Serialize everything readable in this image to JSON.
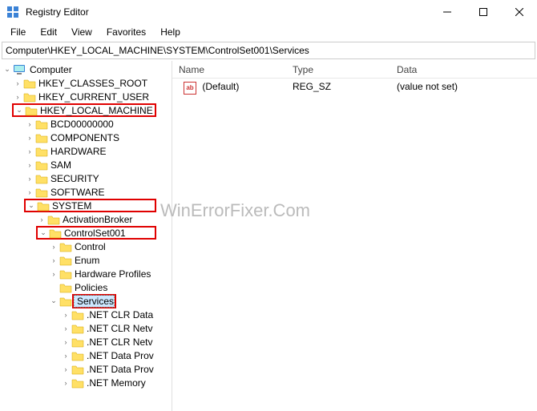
{
  "title": "Registry Editor",
  "menu": {
    "file": "File",
    "edit": "Edit",
    "view": "View",
    "favorites": "Favorites",
    "help": "Help"
  },
  "address": "Computer\\HKEY_LOCAL_MACHINE\\SYSTEM\\ControlSet001\\Services",
  "columns": {
    "name": "Name",
    "type": "Type",
    "data": "Data"
  },
  "value_row": {
    "name": "(Default)",
    "type": "REG_SZ",
    "data": "(value not set)",
    "icon_text": "ab"
  },
  "tree": {
    "computer": "Computer",
    "hkcr": "HKEY_CLASSES_ROOT",
    "hkcu": "HKEY_CURRENT_USER",
    "hklm": "HKEY_LOCAL_MACHINE",
    "bcd": "BCD00000000",
    "components": "COMPONENTS",
    "hardware": "HARDWARE",
    "sam": "SAM",
    "security": "SECURITY",
    "software": "SOFTWARE",
    "system": "SYSTEM",
    "activationbroker": "ActivationBroker",
    "controlset001": "ControlSet001",
    "control": "Control",
    "enum": "Enum",
    "hwprofiles": "Hardware Profiles",
    "policies": "Policies",
    "services": "Services",
    "netclrdata": ".NET CLR Data",
    "netclrnetv1": ".NET CLR Netv",
    "netclrnetv2": ".NET CLR Netv",
    "netdataprov1": ".NET Data Prov",
    "netdataprov2": ".NET Data Prov",
    "netmemory": ".NET Memory"
  },
  "watermark": "WinErrorFixer.Com"
}
